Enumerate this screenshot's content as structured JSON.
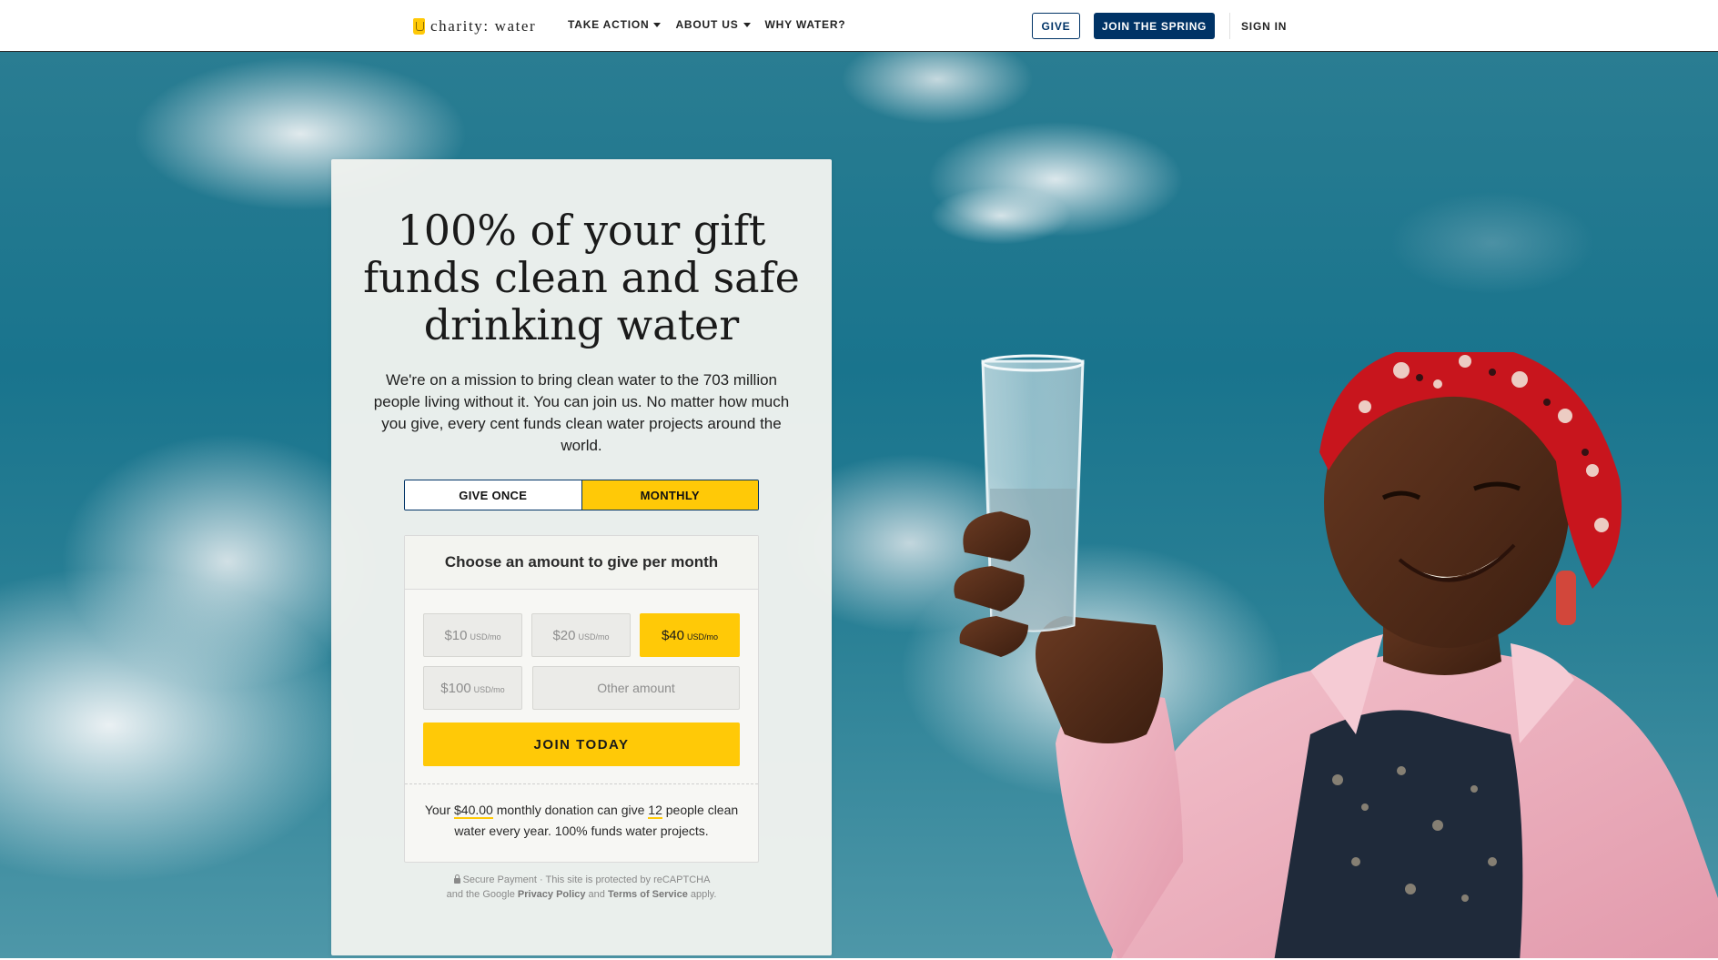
{
  "header": {
    "logo_text": "charity: water",
    "nav": [
      {
        "label": "TAKE ACTION",
        "dropdown": true
      },
      {
        "label": "ABOUT US",
        "dropdown": true
      },
      {
        "label": "WHY WATER?",
        "dropdown": false
      }
    ],
    "give_label": "GIVE",
    "spring_label": "JOIN THE SPRING",
    "sign_in_label": "SIGN IN"
  },
  "card": {
    "title": "100% of your gift funds clean and safe drinking water",
    "description": "We're on a mission to bring clean water to the 703 million people living without it. You can join us. No matter how much you give, every cent funds clean water projects around the world.",
    "frequency": {
      "once_label": "GIVE ONCE",
      "monthly_label": "MONTHLY",
      "selected": "monthly"
    },
    "amount_heading": "Choose an amount to give per month",
    "amounts": [
      {
        "value": "$10",
        "unit": "USD/mo",
        "selected": false
      },
      {
        "value": "$20",
        "unit": "USD/mo",
        "selected": false
      },
      {
        "value": "$40",
        "unit": "USD/mo",
        "selected": true
      },
      {
        "value": "$100",
        "unit": "USD/mo",
        "selected": false
      }
    ],
    "other_placeholder": "Other amount",
    "join_label": "JOIN TODAY",
    "impact": {
      "prefix": "Your ",
      "amount": "$40.00",
      "middle": " monthly donation can give ",
      "people": "12",
      "suffix": " people clean water every year. 100% funds water projects."
    },
    "secure": {
      "line1": "Secure Payment · This site is protected by reCAPTCHA",
      "line2_prefix": "and the Google ",
      "privacy": "Privacy Policy",
      "and": " and ",
      "terms": "Terms of Service",
      "line2_suffix": " apply."
    }
  },
  "colors": {
    "accent_yellow": "#ffc907",
    "navy": "#003366",
    "sky": "#19748d"
  }
}
